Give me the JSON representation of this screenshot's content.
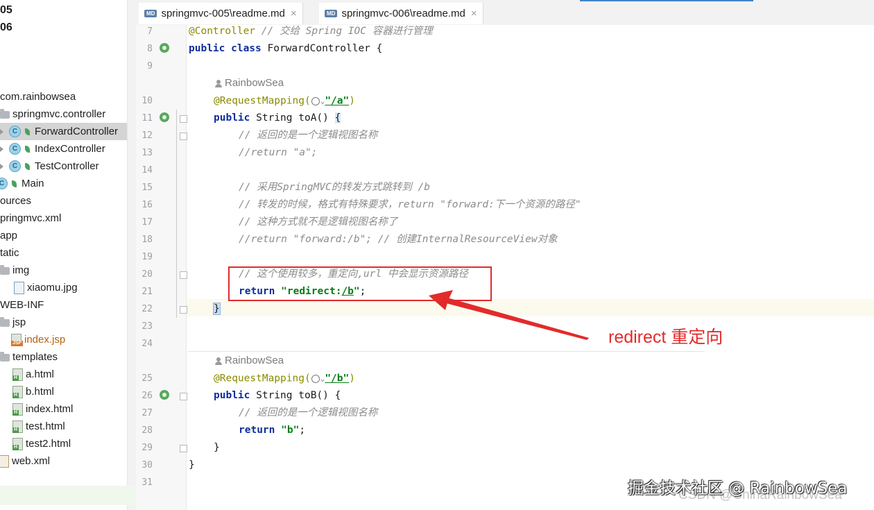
{
  "project_tree": {
    "items": [
      {
        "label": "05",
        "icon": "none",
        "bold": true
      },
      {
        "label": "06",
        "icon": "none",
        "bold": true
      },
      {
        "label": "com.rainbowsea",
        "icon": "none"
      },
      {
        "label": "springmvc.controller",
        "icon": "folder-icon"
      },
      {
        "label": "ForwardController",
        "icon": "class-icon",
        "selected": true
      },
      {
        "label": "IndexController",
        "icon": "class-icon"
      },
      {
        "label": "TestController",
        "icon": "class-icon"
      },
      {
        "label": "Main",
        "icon": "class-icon"
      },
      {
        "label": "ources",
        "icon": "none"
      },
      {
        "label": "pringmvc.xml",
        "icon": "none"
      },
      {
        "label": "app",
        "icon": "none"
      },
      {
        "label": "tatic",
        "icon": "none"
      },
      {
        "label": "img",
        "icon": "folder-icon"
      },
      {
        "label": "xiaomu.jpg",
        "icon": "image-file-icon"
      },
      {
        "label": "WEB-INF",
        "icon": "none"
      },
      {
        "label": "jsp",
        "icon": "folder-icon"
      },
      {
        "label": "index.jsp",
        "icon": "jsp-file-icon"
      },
      {
        "label": "templates",
        "icon": "folder-icon"
      },
      {
        "label": "a.html",
        "icon": "html-file-icon"
      },
      {
        "label": "b.html",
        "icon": "html-file-icon"
      },
      {
        "label": "index.html",
        "icon": "html-file-icon"
      },
      {
        "label": "test.html",
        "icon": "html-file-icon"
      },
      {
        "label": "test2.html",
        "icon": "html-file-icon"
      },
      {
        "label": "web.xml",
        "icon": "xml-file-icon"
      }
    ]
  },
  "tabs": [
    {
      "label": "springmvc-005\\readme.md",
      "badge": "MD"
    },
    {
      "label": "springmvc-006\\readme.md",
      "badge": "MD"
    }
  ],
  "editor": {
    "line_numbers": [
      "7",
      "8",
      "9",
      "10",
      "11",
      "12",
      "13",
      "14",
      "15",
      "16",
      "17",
      "18",
      "19",
      "20",
      "21",
      "22",
      "23",
      "24",
      "25",
      "26",
      "27",
      "28",
      "29",
      "30",
      "31"
    ],
    "lines": {
      "l7_ann": "@Controller",
      "l7_cm": " // 交给 Spring IOC 容器进行管理",
      "l8_kw": "public class",
      "l8_rest": " ForwardController {",
      "hint1": "RainbowSea",
      "l10_ann": "@RequestMapping(",
      "l10_str": "\"/a\"",
      "l10_end": ")",
      "l11_kw": "public",
      "l11_rest": " String toA() ",
      "l11_brace": "{",
      "l12": "// 返回的是一个逻辑视图名称",
      "l13": "//return \"a\";",
      "l15": "// 采用SpringMVC的转发方式跳转到 /b",
      "l16": "// 转发的时候，格式有特殊要求，return \"forward:下一个资源的路径\"",
      "l17": "// 这种方式就不是逻辑视图名称了",
      "l18": "//return \"forward:/b\"; // 创建InternalResourceView对象",
      "l20": "// 这个使用较多，重定向,url 中会显示资源路径",
      "l21_kw": "return",
      "l21_str_a": "\"redirect:",
      "l21_str_b": "/b",
      "l21_str_c": "\"",
      "l21_end": ";",
      "l22": "}",
      "hint2": "RainbowSea",
      "l25_ann": "@RequestMapping(",
      "l25_str": "\"/b\"",
      "l25_end": ")",
      "l26_kw": "public",
      "l26_rest": " String toB() {",
      "l27": "// 返回的是一个逻辑视图名称",
      "l28_kw": "return",
      "l28_str": "\"b\"",
      "l28_end": ";",
      "l29": "}",
      "l30": "}"
    }
  },
  "annotation": {
    "label": "redirect 重定向",
    "color": "#e22b2b"
  },
  "watermarks": {
    "primary": "掘金技术社区 @ RainbowSea",
    "secondary": "CSDN @ChinaRainbowSea"
  }
}
